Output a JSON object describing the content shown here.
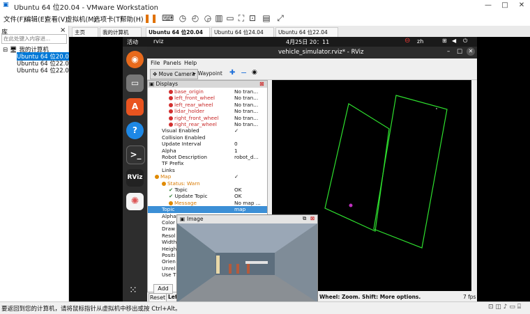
{
  "window": {
    "title": "Ubuntu 64 位20.04 - VMware Workstation",
    "controls": [
      "—",
      "□",
      "✕"
    ]
  },
  "menu": [
    "文件(F)",
    "编辑(E)",
    "查看(V)",
    "虚拟机(M)",
    "选项卡(T)",
    "帮助(H)"
  ],
  "library": {
    "header": "库",
    "close": "×",
    "search_placeholder": "在此处键入内容进...",
    "root": "我的计算机",
    "vms": [
      "Ubuntu 64 位20.04",
      "Ubuntu 64 位22.04",
      "Ubuntu 64 位22.04"
    ]
  },
  "tabs": [
    "主页",
    "我的计算机",
    "Ubuntu 64 位20.04",
    "Ubuntu 64 位24.04",
    "Ubuntu 64 位22.04"
  ],
  "statusbar": {
    "text": "要返回到您的计算机，请将鼠标指针从虚拟机中移出或按 Ctrl+Alt。"
  },
  "guest": {
    "activities": "活动",
    "app": "rviz",
    "datetime": "4月25日  20：11",
    "lang": "zh",
    "dock_labels": [
      "RViz"
    ]
  },
  "rviz": {
    "title": "vehicle_simulator.rviz* - RViz",
    "menu": [
      "File",
      "Panels",
      "Help"
    ],
    "tools": [
      "Move Camera",
      "Waypoint"
    ],
    "panel_title": "Displays",
    "rows": [
      {
        "name": "base_origin",
        "value": "No tran...",
        "style": "red",
        "indent": 2
      },
      {
        "name": "left_front_wheel",
        "value": "No tran...",
        "style": "red",
        "indent": 2
      },
      {
        "name": "left_rear_wheel",
        "value": "No tran...",
        "style": "red",
        "indent": 2
      },
      {
        "name": "lidar_holder",
        "value": "No tran...",
        "style": "red",
        "indent": 2
      },
      {
        "name": "right_front_wheel",
        "value": "No tran...",
        "style": "red",
        "indent": 2
      },
      {
        "name": "right_rear_wheel",
        "value": "No tran...",
        "style": "red",
        "indent": 2
      },
      {
        "name": "Visual Enabled",
        "value": "✓",
        "style": "",
        "indent": 1
      },
      {
        "name": "Collision Enabled",
        "value": "",
        "style": "",
        "indent": 1
      },
      {
        "name": "Update Interval",
        "value": "0",
        "style": "",
        "indent": 1
      },
      {
        "name": "Alpha",
        "value": "1",
        "style": "",
        "indent": 1
      },
      {
        "name": "Robot Description",
        "value": "robot_d...",
        "style": "",
        "indent": 1
      },
      {
        "name": "TF Prefix",
        "value": "",
        "style": "",
        "indent": 1
      },
      {
        "name": "Links",
        "value": "",
        "style": "",
        "indent": 1
      },
      {
        "name": "Map",
        "value": "✓",
        "style": "orange-dot",
        "indent": 0
      },
      {
        "name": "Status: Warn",
        "value": "",
        "style": "orange-dot",
        "indent": 1
      },
      {
        "name": "Topic",
        "value": "OK",
        "style": "check",
        "indent": 2
      },
      {
        "name": "Update Topic",
        "value": "OK",
        "style": "check",
        "indent": 2
      },
      {
        "name": "Message",
        "value": "No map ...",
        "style": "orange-dot",
        "indent": 2
      },
      {
        "name": "Topic",
        "value": "map",
        "style": "selected",
        "indent": 1
      },
      {
        "name": "Alpha",
        "value": "",
        "style": "",
        "indent": 1
      },
      {
        "name": "Color",
        "value": "",
        "style": "",
        "indent": 1
      },
      {
        "name": "Draw",
        "value": "",
        "style": "",
        "indent": 1
      },
      {
        "name": "Resol",
        "value": "",
        "style": "",
        "indent": 1
      },
      {
        "name": "Width",
        "value": "",
        "style": "",
        "indent": 1
      },
      {
        "name": "Height",
        "value": "",
        "style": "",
        "indent": 1
      },
      {
        "name": "Positi",
        "value": "",
        "style": "",
        "indent": 1
      },
      {
        "name": "Orien",
        "value": "",
        "style": "",
        "indent": 1
      },
      {
        "name": "Unrel",
        "value": "",
        "style": "",
        "indent": 1
      },
      {
        "name": "Use T",
        "value": "",
        "style": "",
        "indent": 1
      }
    ],
    "add_button": "Add",
    "reset_button": "Reset",
    "left_hint": "Lef",
    "status_hint": "Wheel: Zoom. Shift: More options.",
    "fps": "7 fps",
    "image_window_title": "Image"
  }
}
